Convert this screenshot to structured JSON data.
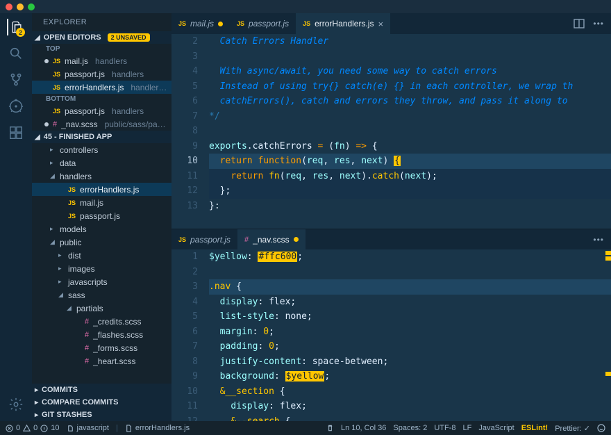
{
  "titlebar": {},
  "activity": {
    "badge": "2"
  },
  "explorer": {
    "title": "EXPLORER",
    "openEditors": {
      "label": "OPEN EDITORS",
      "unsaved": "2 UNSAVED",
      "groups": [
        {
          "label": "TOP",
          "items": [
            {
              "filename": "mail.js",
              "path": "handlers",
              "modified": true,
              "icon": "js"
            },
            {
              "filename": "passport.js",
              "path": "handlers",
              "modified": false,
              "icon": "js"
            },
            {
              "filename": "errorHandlers.js",
              "path": "handler…",
              "modified": false,
              "icon": "js",
              "active": true
            }
          ]
        },
        {
          "label": "BOTTOM",
          "items": [
            {
              "filename": "passport.js",
              "path": "handlers",
              "modified": false,
              "icon": "js"
            },
            {
              "filename": "_nav.scss",
              "path": "public/sass/pa…",
              "modified": true,
              "icon": "scss"
            }
          ]
        }
      ]
    },
    "project": {
      "label": "45 - FINISHED APP",
      "tree": [
        {
          "name": "controllers",
          "type": "folder",
          "depth": 1,
          "open": false
        },
        {
          "name": "data",
          "type": "folder",
          "depth": 1,
          "open": false
        },
        {
          "name": "handlers",
          "type": "folder",
          "depth": 1,
          "open": true
        },
        {
          "name": "errorHandlers.js",
          "type": "file",
          "depth": 2,
          "icon": "js",
          "active": true
        },
        {
          "name": "mail.js",
          "type": "file",
          "depth": 2,
          "icon": "js"
        },
        {
          "name": "passport.js",
          "type": "file",
          "depth": 2,
          "icon": "js"
        },
        {
          "name": "models",
          "type": "folder",
          "depth": 1,
          "open": false
        },
        {
          "name": "public",
          "type": "folder",
          "depth": 1,
          "open": true
        },
        {
          "name": "dist",
          "type": "folder",
          "depth": 2,
          "open": false
        },
        {
          "name": "images",
          "type": "folder",
          "depth": 2,
          "open": false
        },
        {
          "name": "javascripts",
          "type": "folder",
          "depth": 2,
          "open": false
        },
        {
          "name": "sass",
          "type": "folder",
          "depth": 2,
          "open": true
        },
        {
          "name": "partials",
          "type": "folder",
          "depth": 3,
          "open": true
        },
        {
          "name": "_credits.scss",
          "type": "file",
          "depth": 4,
          "icon": "scss"
        },
        {
          "name": "_flashes.scss",
          "type": "file",
          "depth": 4,
          "icon": "scss"
        },
        {
          "name": "_forms.scss",
          "type": "file",
          "depth": 4,
          "icon": "scss"
        },
        {
          "name": "_heart.scss",
          "type": "file",
          "depth": 4,
          "icon": "scss"
        }
      ]
    },
    "bottomSections": [
      "COMMITS",
      "COMPARE COMMITS",
      "GIT STASHES"
    ]
  },
  "editorTop": {
    "tabs": [
      {
        "label": "mail.js",
        "icon": "js",
        "modified": true
      },
      {
        "label": "passport.js",
        "icon": "js"
      },
      {
        "label": "errorHandlers.js",
        "icon": "js",
        "active": true,
        "close": true
      }
    ],
    "lines": [
      {
        "n": 2,
        "html": "  Catch Errors Handler",
        "cls": "cm"
      },
      {
        "n": 3,
        "html": "",
        "cls": "cm"
      },
      {
        "n": 4,
        "html": "  With async/await, you need some way to catch errors",
        "cls": "cm"
      },
      {
        "n": 5,
        "html": "  Instead of using try{} catch(e) {} in each controller, we wrap th",
        "cls": "cm"
      },
      {
        "n": 6,
        "html": "  catchErrors(), catch and errors they throw, and pass it along to ",
        "cls": "cm"
      },
      {
        "n": 7,
        "html": "*/",
        "cls": "cmd"
      },
      {
        "n": 8,
        "html": ""
      },
      {
        "n": 9,
        "tokens": [
          [
            "va",
            "exports"
          ],
          [
            "pu",
            "."
          ],
          [
            "pl",
            "catchErrors"
          ],
          [
            "pl",
            " "
          ],
          [
            "op",
            "="
          ],
          [
            "pl",
            " "
          ],
          [
            "pu",
            "("
          ],
          [
            "va",
            "fn"
          ],
          [
            "pu",
            ")"
          ],
          [
            "pl",
            " "
          ],
          [
            "op",
            "=>"
          ],
          [
            "pl",
            " "
          ],
          [
            "br",
            "{"
          ]
        ]
      },
      {
        "n": 10,
        "cur": true,
        "hl": true,
        "tokens": [
          [
            "pl",
            "  "
          ],
          [
            "kw",
            "return"
          ],
          [
            "pl",
            " "
          ],
          [
            "kw",
            "function"
          ],
          [
            "pu",
            "("
          ],
          [
            "va",
            "req"
          ],
          [
            "pu",
            ", "
          ],
          [
            "va",
            "res"
          ],
          [
            "pu",
            ", "
          ],
          [
            "va",
            "next"
          ],
          [
            "pu",
            ") "
          ],
          [
            "cursor",
            "{"
          ]
        ]
      },
      {
        "n": 11,
        "hl2": true,
        "tokens": [
          [
            "pl",
            "    "
          ],
          [
            "kw",
            "return"
          ],
          [
            "pl",
            " "
          ],
          [
            "fn",
            "fn"
          ],
          [
            "pu",
            "("
          ],
          [
            "va",
            "req"
          ],
          [
            "pu",
            ", "
          ],
          [
            "va",
            "res"
          ],
          [
            "pu",
            ", "
          ],
          [
            "va",
            "next"
          ],
          [
            "pu",
            ")."
          ],
          [
            "fn",
            "catch"
          ],
          [
            "pu",
            "("
          ],
          [
            "va",
            "next"
          ],
          [
            "pu",
            ");"
          ]
        ]
      },
      {
        "n": 12,
        "hl2": true,
        "tokens": [
          [
            "pl",
            "  "
          ],
          [
            "br",
            "}"
          ],
          [
            "pu",
            ";"
          ]
        ]
      },
      {
        "n": 13,
        "tokens": [
          [
            "pu",
            "}:"
          ]
        ]
      }
    ]
  },
  "editorBottom": {
    "tabs": [
      {
        "label": "passport.js",
        "icon": "js"
      },
      {
        "label": "_nav.scss",
        "icon": "scss",
        "active": true,
        "modified": true
      }
    ],
    "lines": [
      {
        "n": 1,
        "tokens": [
          [
            "va",
            "$yellow"
          ],
          [
            "pu",
            ": "
          ],
          [
            "hex",
            "#ffc600"
          ],
          [
            "pu",
            ";"
          ]
        ]
      },
      {
        "n": 2,
        "html": ""
      },
      {
        "n": 3,
        "hl": true,
        "tokens": [
          [
            "fn",
            ".nav"
          ],
          [
            "pl",
            " "
          ],
          [
            "br",
            "{"
          ]
        ]
      },
      {
        "n": 4,
        "tokens": [
          [
            "pl",
            "  "
          ],
          [
            "va",
            "display"
          ],
          [
            "pu",
            ": "
          ],
          [
            "pl",
            "flex"
          ],
          [
            "pu",
            ";"
          ]
        ]
      },
      {
        "n": 5,
        "tokens": [
          [
            "pl",
            "  "
          ],
          [
            "va",
            "list-style"
          ],
          [
            "pu",
            ": "
          ],
          [
            "pl",
            "none"
          ],
          [
            "pu",
            ";"
          ]
        ]
      },
      {
        "n": 6,
        "tokens": [
          [
            "pl",
            "  "
          ],
          [
            "va",
            "margin"
          ],
          [
            "pu",
            ": "
          ],
          [
            "fn",
            "0"
          ],
          [
            "pu",
            ";"
          ]
        ]
      },
      {
        "n": 7,
        "tokens": [
          [
            "pl",
            "  "
          ],
          [
            "va",
            "padding"
          ],
          [
            "pu",
            ": "
          ],
          [
            "fn",
            "0"
          ],
          [
            "pu",
            ";"
          ]
        ]
      },
      {
        "n": 8,
        "tokens": [
          [
            "pl",
            "  "
          ],
          [
            "va",
            "justify-content"
          ],
          [
            "pu",
            ": "
          ],
          [
            "pl",
            "space-between"
          ],
          [
            "pu",
            ";"
          ]
        ]
      },
      {
        "n": 9,
        "tokens": [
          [
            "pl",
            "  "
          ],
          [
            "va",
            "background"
          ],
          [
            "pu",
            ": "
          ],
          [
            "hex",
            "$yellow"
          ],
          [
            "pu",
            ";"
          ]
        ]
      },
      {
        "n": 10,
        "tokens": [
          [
            "pl",
            "  "
          ],
          [
            "fn",
            "&__section"
          ],
          [
            "pl",
            " "
          ],
          [
            "br",
            "{"
          ]
        ]
      },
      {
        "n": 11,
        "tokens": [
          [
            "pl",
            "    "
          ],
          [
            "va",
            "display"
          ],
          [
            "pu",
            ": "
          ],
          [
            "pl",
            "flex"
          ],
          [
            "pu",
            ";"
          ]
        ]
      },
      {
        "n": 12,
        "tokens": [
          [
            "pl",
            "    "
          ],
          [
            "fn",
            "&--search"
          ],
          [
            "pl",
            " "
          ],
          [
            "br",
            "{"
          ]
        ]
      }
    ]
  },
  "status": {
    "errors": "0",
    "warnings": "0",
    "info": "10",
    "lang_scope": "javascript",
    "file": "errorHandlers.js",
    "lncol": "Ln 10, Col 36",
    "spaces": "Spaces: 2",
    "encoding": "UTF-8",
    "eol": "LF",
    "language": "JavaScript",
    "eslint": "ESLint!",
    "prettier": "Prettier: ✓"
  }
}
